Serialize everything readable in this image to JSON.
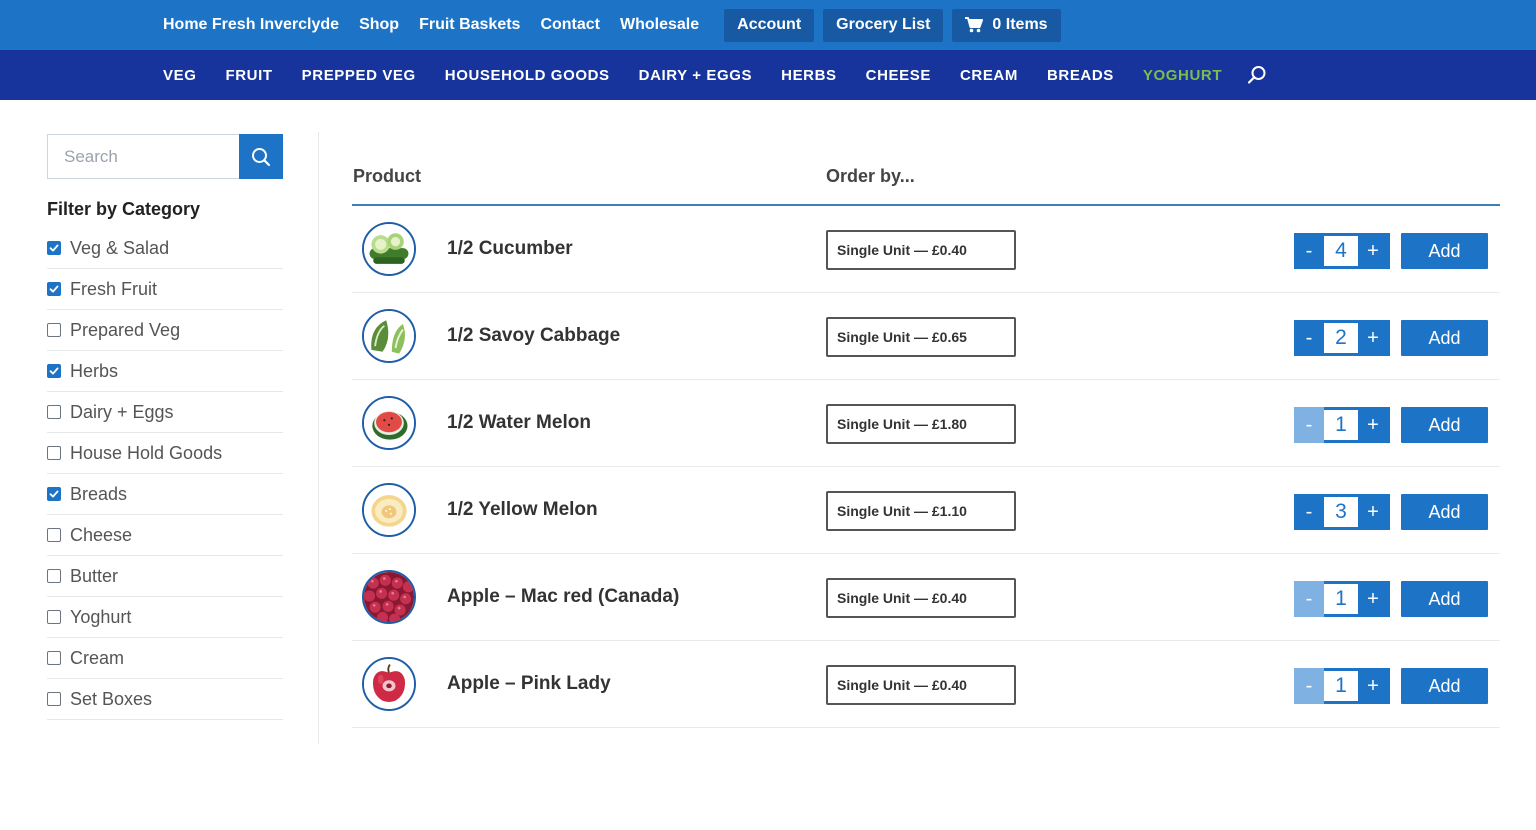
{
  "topnav": {
    "links": [
      "Home Fresh Inverclyde",
      "Shop",
      "Fruit Baskets",
      "Contact",
      "Wholesale"
    ],
    "account": "Account",
    "grocery_list": "Grocery List",
    "cart": "0 Items",
    "cart_icon": "cart-icon"
  },
  "catnav": {
    "items": [
      "VEG",
      "FRUIT",
      "PREPPED VEG",
      "HOUSEHOLD GOODS",
      "DAIRY + EGGS",
      "HERBS",
      "CHEESE",
      "CREAM",
      "BREADS",
      "YOGHURT"
    ],
    "active": "YOGHURT",
    "active_color": "#7dbd4f",
    "search_icon": "search-icon"
  },
  "sidebar": {
    "search_placeholder": "Search",
    "filter_title": "Filter by Category",
    "categories": [
      {
        "label": "Veg & Salad",
        "checked": true
      },
      {
        "label": "Fresh Fruit",
        "checked": true
      },
      {
        "label": "Prepared Veg",
        "checked": false
      },
      {
        "label": "Herbs",
        "checked": true
      },
      {
        "label": "Dairy + Eggs",
        "checked": false
      },
      {
        "label": "House Hold Goods",
        "checked": false
      },
      {
        "label": "Breads",
        "checked": true
      },
      {
        "label": "Cheese",
        "checked": false
      },
      {
        "label": "Butter",
        "checked": false
      },
      {
        "label": "Yoghurt",
        "checked": false
      },
      {
        "label": "Cream",
        "checked": false
      },
      {
        "label": "Set Boxes",
        "checked": false
      }
    ]
  },
  "table": {
    "col_product": "Product",
    "col_order": "Order by...",
    "minus_label": "-",
    "plus_label": "+",
    "add_label": "Add",
    "rows": [
      {
        "name": "1/2 Cucumber",
        "unit": "Single Unit — £0.40",
        "qty": "4",
        "minus_disabled": false,
        "image": "cucumber"
      },
      {
        "name": "1/2 Savoy Cabbage",
        "unit": "Single Unit — £0.65",
        "qty": "2",
        "minus_disabled": false,
        "image": "cabbage"
      },
      {
        "name": "1/2 Water Melon",
        "unit": "Single Unit — £1.80",
        "qty": "1",
        "minus_disabled": true,
        "image": "watermelon"
      },
      {
        "name": "1/2 Yellow Melon",
        "unit": "Single Unit — £1.10",
        "qty": "3",
        "minus_disabled": false,
        "image": "yellow-melon"
      },
      {
        "name": "Apple – Mac red (Canada)",
        "unit": "Single Unit — £0.40",
        "qty": "1",
        "minus_disabled": true,
        "image": "red-apples"
      },
      {
        "name": "Apple – Pink Lady",
        "unit": "Single Unit — £0.40",
        "qty": "1",
        "minus_disabled": true,
        "image": "pink-apple"
      }
    ]
  },
  "colors": {
    "top_bar": "#1d73c6",
    "category_bar": "#16349b",
    "button_dark": "#175aa3",
    "accent": "#1d73c6"
  }
}
